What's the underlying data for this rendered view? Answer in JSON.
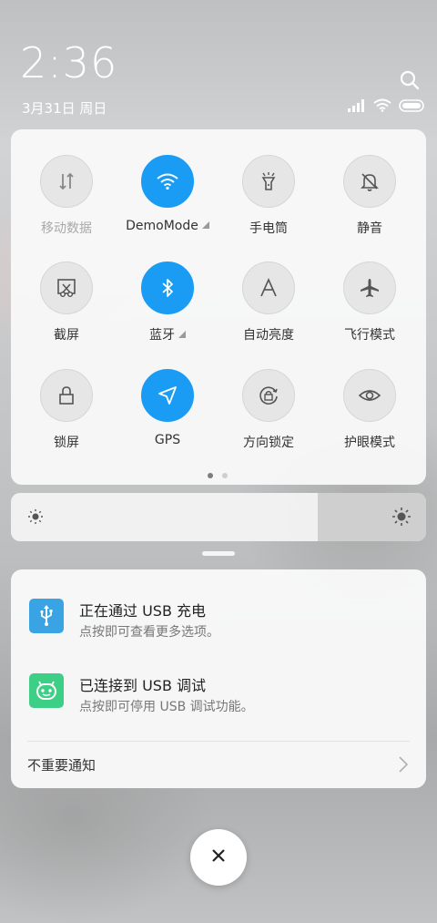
{
  "status_bar": {
    "time": "2:36",
    "date": "3月31日 周日",
    "icons": [
      "signal-icon",
      "wifi-icon",
      "battery-icon"
    ]
  },
  "header": {
    "search_icon": "search-icon"
  },
  "quick_settings": {
    "tiles": [
      {
        "label": "移动数据",
        "icon": "mobile-data-icon",
        "active": false,
        "disabled": true
      },
      {
        "label": "DemoMode",
        "icon": "wifi-icon",
        "active": true,
        "has_menu": true
      },
      {
        "label": "手电筒",
        "icon": "flashlight-icon",
        "active": false
      },
      {
        "label": "静音",
        "icon": "bell-off-icon",
        "active": false
      },
      {
        "label": "截屏",
        "icon": "screenshot-icon",
        "active": false
      },
      {
        "label": "蓝牙",
        "icon": "bluetooth-icon",
        "active": true,
        "has_menu": true
      },
      {
        "label": "自动亮度",
        "icon": "auto-brightness-icon",
        "active": false
      },
      {
        "label": "飞行模式",
        "icon": "airplane-icon",
        "active": false
      },
      {
        "label": "锁屏",
        "icon": "lock-icon",
        "active": false
      },
      {
        "label": "GPS",
        "icon": "location-arrow-icon",
        "active": true
      },
      {
        "label": "方向锁定",
        "icon": "rotation-lock-icon",
        "active": false
      },
      {
        "label": "护眼模式",
        "icon": "eye-icon",
        "active": false
      }
    ],
    "page_count": 2,
    "current_page": 1
  },
  "brightness": {
    "level": 0.74
  },
  "notifications": [
    {
      "title": "正在通过 USB 充电",
      "text": "点按即可查看更多选项。",
      "icon": "usb-icon",
      "color": "#3aa3e3"
    },
    {
      "title": "已连接到 USB 调试",
      "text": "点按即可停用 USB 调试功能。",
      "icon": "android-icon",
      "color": "#3dcf86"
    }
  ],
  "minor_notifications_label": "不重要通知",
  "colors": {
    "accent": "#1a9cf5",
    "usb": "#3aa3e3",
    "android": "#3dcf86"
  }
}
